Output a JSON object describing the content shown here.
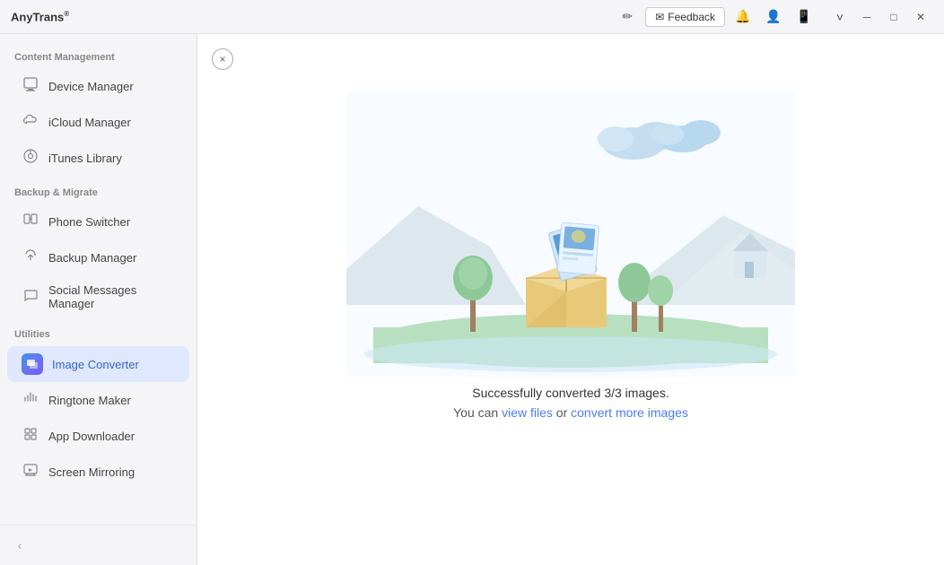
{
  "app": {
    "title": "AnyTrans",
    "trademark": "®"
  },
  "titlebar": {
    "feedback_label": "Feedback",
    "feedback_icon": "✉",
    "edit_icon": "✏",
    "bell_icon": "🔔",
    "user_icon": "👤",
    "phone_icon": "📱",
    "chevron_icon": "˅",
    "minimize_icon": "─",
    "maximize_icon": "□",
    "close_icon": "✕"
  },
  "sidebar": {
    "sections": [
      {
        "label": "Content Management",
        "items": [
          {
            "id": "device-manager",
            "label": "Device Manager",
            "icon": "📱"
          },
          {
            "id": "icloud-manager",
            "label": "iCloud Manager",
            "icon": "☁"
          },
          {
            "id": "itunes-library",
            "label": "iTunes Library",
            "icon": "🎵"
          }
        ]
      },
      {
        "label": "Backup & Migrate",
        "items": [
          {
            "id": "phone-switcher",
            "label": "Phone Switcher",
            "icon": "🔄"
          },
          {
            "id": "backup-manager",
            "label": "Backup Manager",
            "icon": "🔃"
          },
          {
            "id": "social-messages",
            "label": "Social Messages Manager",
            "icon": "💬"
          }
        ]
      },
      {
        "label": "Utilities",
        "items": [
          {
            "id": "image-converter",
            "label": "Image Converter",
            "icon": "🖼",
            "active": true
          },
          {
            "id": "ringtone-maker",
            "label": "Ringtone Maker",
            "icon": "🔔"
          },
          {
            "id": "app-downloader",
            "label": "App Downloader",
            "icon": "⬇"
          },
          {
            "id": "screen-mirroring",
            "label": "Screen Mirroring",
            "icon": "📺"
          }
        ]
      }
    ],
    "collapse_label": "<"
  },
  "content": {
    "close_button_label": "×",
    "success_message": "Successfully converted 3/3 images.",
    "action_prefix": "You can",
    "view_files_label": "view files",
    "action_or": "or",
    "convert_more_label": "convert more images"
  },
  "illustration": {
    "colors": {
      "sky": "#edf4fb",
      "cloud1": "#b8d4ea",
      "cloud2": "#cde0f0",
      "mountain1": "#e0e8ee",
      "mountain2": "#d8e5ec",
      "grass": "#c8e6c9",
      "water": "#ddeef8",
      "box_body": "#e8c97a",
      "box_shadow": "#d4a84b",
      "card_blue": "#5b9bd5",
      "card_light": "#d0e8f8",
      "tree_trunk": "#a0856a",
      "tree_leaves": "#8bc89a",
      "roof": "#c8d8e0",
      "house_body": "#e0e8f0"
    }
  }
}
